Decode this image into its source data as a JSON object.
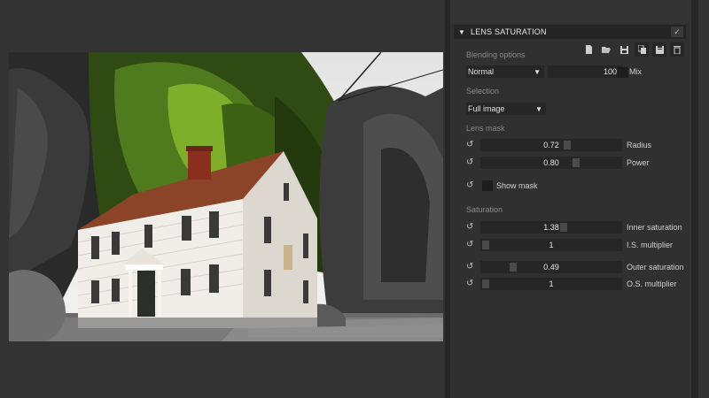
{
  "panel": {
    "title": "LENS SATURATION",
    "blending": {
      "section_label": "Blending options",
      "mode": "Normal",
      "opacity": "100",
      "mix_label": "Mix"
    },
    "selection": {
      "section_label": "Selection",
      "value": "Full image"
    },
    "lens_mask": {
      "section_label": "Lens mask",
      "radius": {
        "value": "0.72",
        "label": "Radius",
        "fraction": 0.72
      },
      "power": {
        "value": "0.80",
        "label": "Power",
        "fraction": 0.8
      },
      "show_mask_label": "Show mask"
    },
    "saturation": {
      "section_label": "Saturation",
      "inner": {
        "value": "1.38",
        "label": "Inner saturation",
        "fraction": 0.69
      },
      "is_multiplier": {
        "value": "1",
        "label": "I.S. multiplier",
        "fraction": 0.0
      },
      "outer": {
        "value": "0.49",
        "label": "Outer saturation",
        "fraction": 0.245
      },
      "os_multiplier": {
        "value": "1",
        "label": "O.S. multiplier",
        "fraction": 0.0
      }
    }
  },
  "icons": {
    "collapse": "▼",
    "check": "✓",
    "reset": "↺",
    "dropdown": "▼",
    "new_preset": "new-file-icon",
    "open_preset": "open-folder-icon",
    "save_preset": "save-icon",
    "copy_preset": "copy-icon",
    "paste_preset": "paste-icon",
    "delete_preset": "delete-icon"
  },
  "colors": {
    "app_background": "#333333",
    "panel_background": "#303030",
    "header_background": "#242424",
    "field_background": "#262626"
  }
}
